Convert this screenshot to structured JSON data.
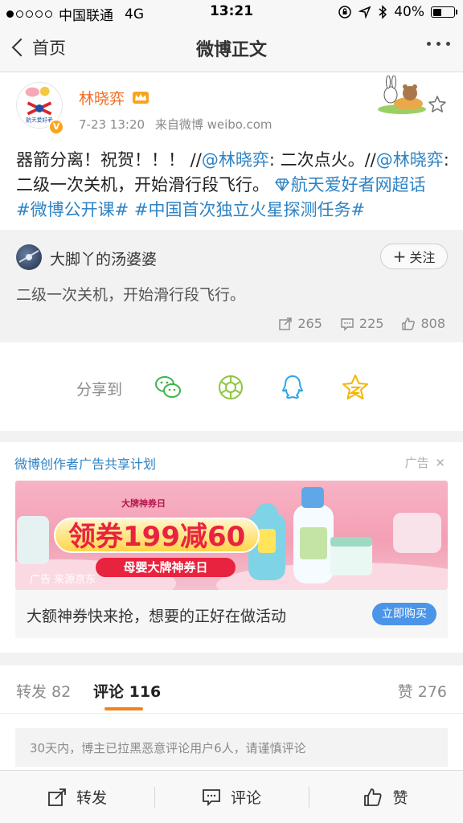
{
  "status_bar": {
    "carrier": "中国联通",
    "network": "4G",
    "time": "13:21",
    "battery": "40%",
    "battery_level": 0.4
  },
  "nav": {
    "back_label": "首页",
    "title": "微博正文"
  },
  "post": {
    "author": "林晓弈",
    "avatar_text": "航天爱好者",
    "verified_badge": "V",
    "timestamp": "7-23 13:20",
    "source": "来自微博 weibo.com",
    "text_part1": "器箭分离！祝贺！！！ //",
    "mention1": "@林晓弈",
    "text_part2": ": 二次点火。//",
    "mention2": "@林晓弈",
    "text_part3": ": 二级一次关机，开始滑行段飞行。  ",
    "topic_super": "航天爱好者网超话",
    "hashtag1": "#微博公开课#",
    "hashtag2": "#中国首次独立火星探测任务#"
  },
  "repost": {
    "author": "大脚丫的汤婆婆",
    "follow_label": "关注",
    "text": "二级一次关机，开始滑行段飞行。",
    "reposts": "265",
    "comments": "225",
    "likes": "808"
  },
  "share": {
    "label": "分享到",
    "targets": [
      "wechat-icon",
      "moments-icon",
      "qq-icon",
      "qzone-icon"
    ]
  },
  "ad": {
    "program": "微博创作者广告共享计划",
    "tag": "广告",
    "source": "广告 来源京东",
    "brand": "大牌神券日",
    "coupon": "领券199减60",
    "strip": "母婴大牌神券日",
    "caption": "大额神券快来抢，想要的正好在做活动",
    "buy_label": "立即购买"
  },
  "tabs": {
    "repost": "转发 82",
    "comment": "评论 116",
    "like": "赞 276"
  },
  "notice": "30天内，博主已拉黑恶意评论用户6人，请谨慎评论",
  "toolbar": {
    "repost": "转发",
    "comment": "评论",
    "like": "赞"
  },
  "colors": {
    "link": "#2d83c5",
    "username": "#f36c21",
    "tab_indicator": "#f28120",
    "buy_button": "#4a95e8"
  }
}
